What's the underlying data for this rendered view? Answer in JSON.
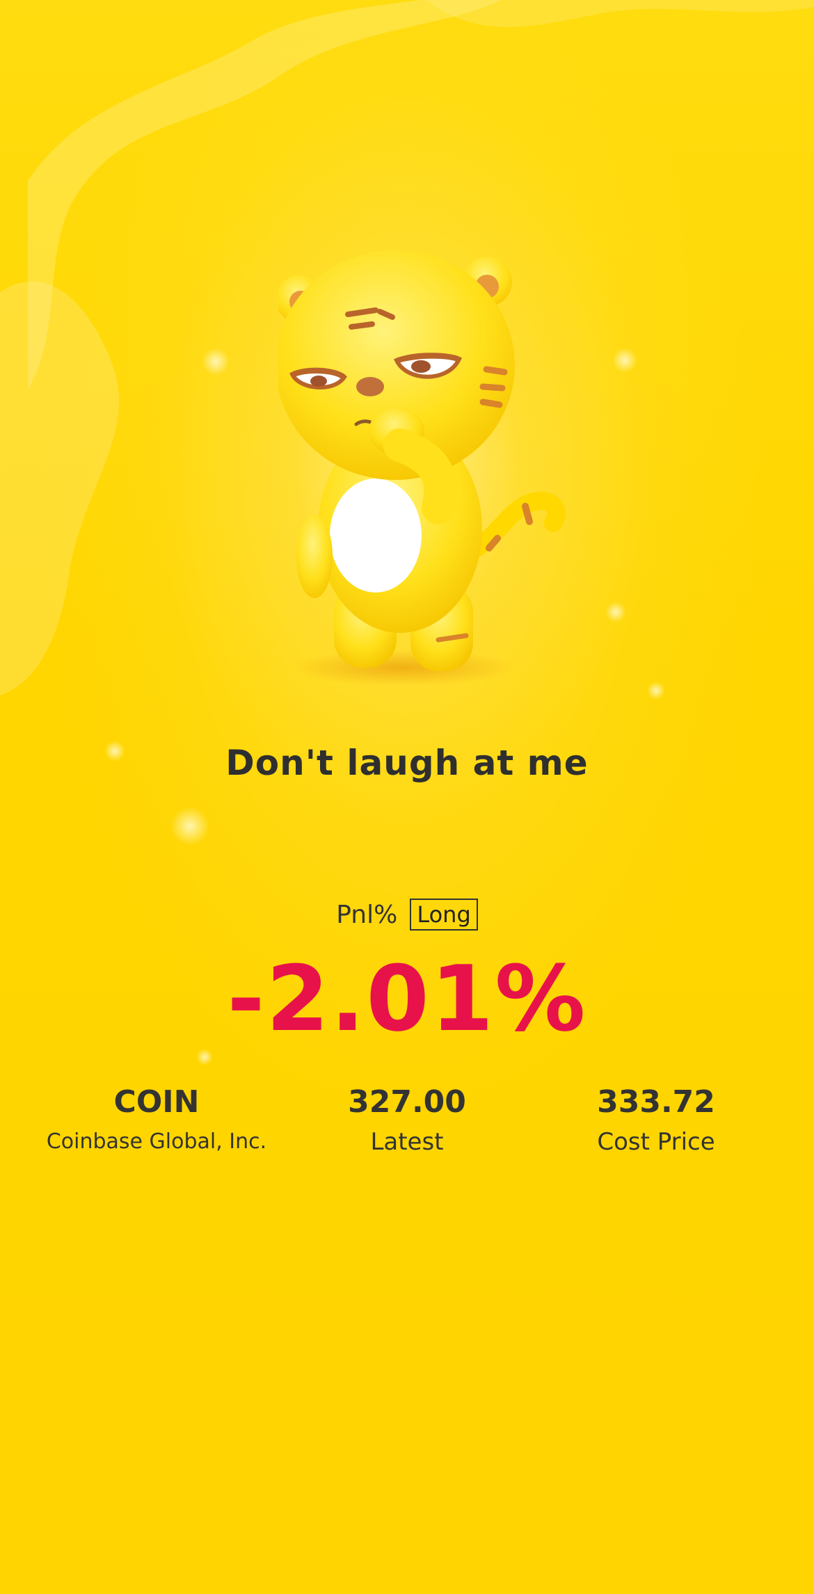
{
  "share_card": {
    "headline": "Don't laugh at me",
    "mascot": "yellow-tiger-mascot",
    "pnl": {
      "label": "Pnl%",
      "direction": "Long",
      "value": "-2.01%",
      "value_color": "#E8124B"
    },
    "stock": {
      "symbol": "COIN",
      "name": "Coinbase Global, Inc.",
      "latest_value": "327.00",
      "latest_label": "Latest",
      "cost_value": "333.72",
      "cost_label": "Cost Price"
    }
  },
  "colors": {
    "background": "#FFD700",
    "text": "#333333",
    "loss": "#E8124B"
  }
}
